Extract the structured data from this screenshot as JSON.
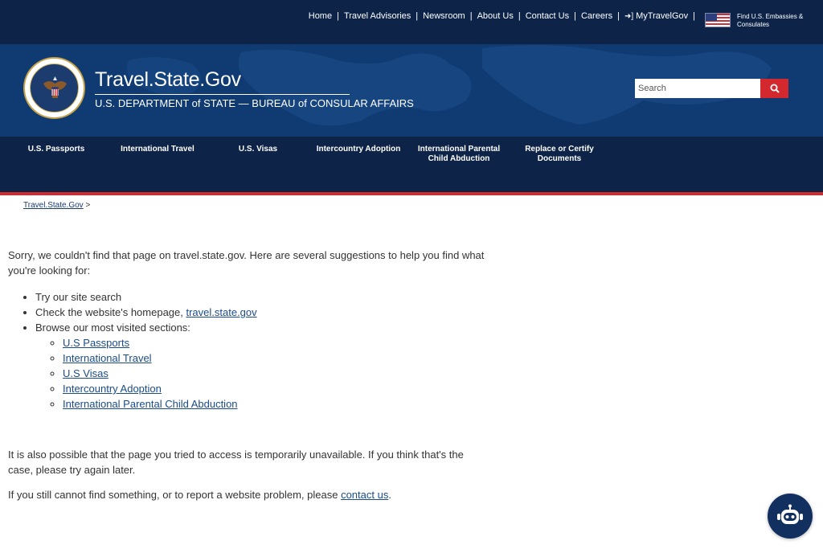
{
  "utility_nav": {
    "items": [
      "Home",
      "Travel Advisories",
      "Newsroom",
      "About Us",
      "Contact Us",
      "Careers",
      "MyTravelGov"
    ],
    "separator": "|",
    "embassies_link": "Find U.S. Embassies & Consulates"
  },
  "header": {
    "site_title": "Travel.State.Gov",
    "subtitle": "U.S. DEPARTMENT of STATE — BUREAU of CONSULAR AFFAIRS",
    "search_placeholder": "Search"
  },
  "main_nav": {
    "items": [
      {
        "label": "U.S. Passports"
      },
      {
        "label": "International Travel"
      },
      {
        "label": "U.S. Visas"
      },
      {
        "label": "Intercountry Adoption"
      },
      {
        "label": "International Parental Child Abduction"
      },
      {
        "label": "Replace or Certify Documents"
      }
    ]
  },
  "breadcrumb": {
    "link": "Travel.State.Gov",
    "separator": ">"
  },
  "content": {
    "intro": "Sorry, we couldn't find that page on travel.state.gov. Here are several suggestions to help you find what you're looking for:",
    "bullet1": "Try our site search",
    "bullet2_prefix": "Check the website's homepage, ",
    "bullet2_link": "travel.state.gov",
    "bullet3": "Browse our most visited sections:",
    "sections": [
      "U.S Passports",
      "International Travel",
      "U.S Visas",
      "Intercountry Adoption",
      "International Parental Child Abduction"
    ],
    "para2": "It is also possible that the page you tried to access is temporarily unavailable. If you think that's the case, please try again later.",
    "para3_prefix": "If you still cannot find something, or to report a website problem, please ",
    "para3_link": "contact us",
    "para3_suffix": "."
  },
  "colors": {
    "navy": "#0d2448",
    "banner_blue": "#0f3a72",
    "accent_red": "#d2282e",
    "link_blue": "#1a4c8b"
  },
  "icons": {
    "search": "magnifier-icon",
    "login": "sign-in-icon",
    "flag": "us-flag-icon",
    "chat": "robot-chat-icon",
    "seal": "department-of-state-seal"
  }
}
